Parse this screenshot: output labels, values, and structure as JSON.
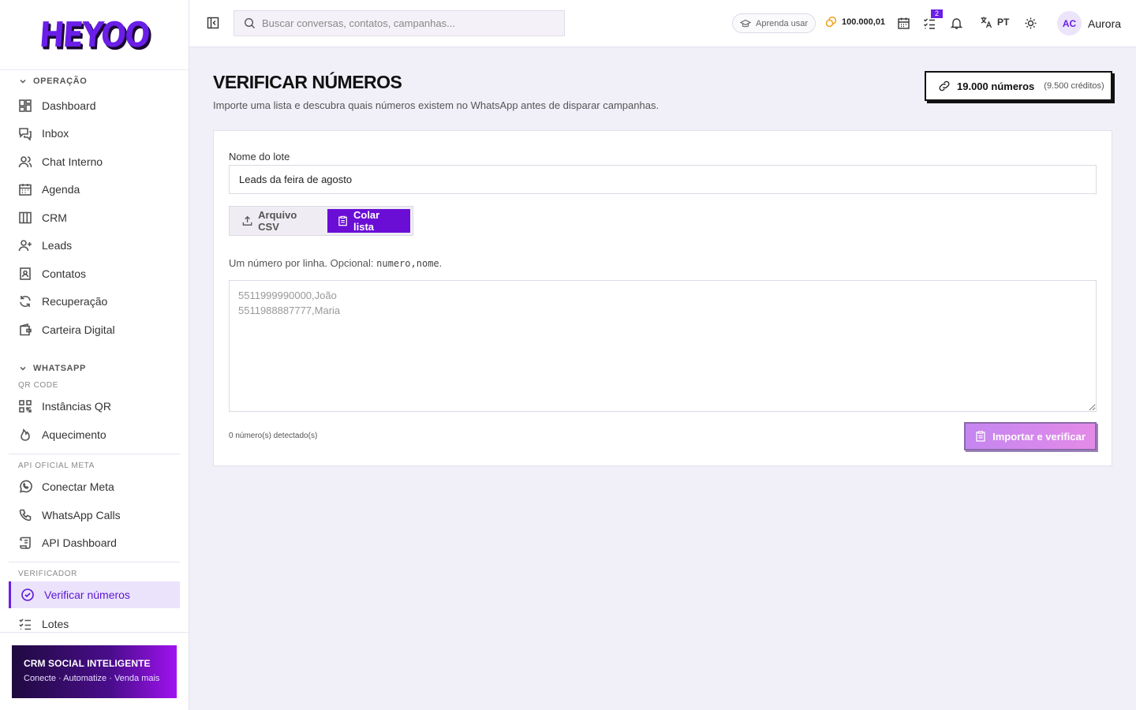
{
  "brand": {
    "logo_text": "HEYOO"
  },
  "topbar": {
    "search_placeholder": "Buscar conversas, contatos, campanhas...",
    "learn_label": "Aprenda usar",
    "credits": "100.000,01",
    "tasks_badge": "2",
    "language": "PT",
    "user": {
      "initials": "AC",
      "name": "Aurora"
    }
  },
  "sidebar": {
    "sections": {
      "operacao": "OPERAÇÃO",
      "whatsapp": "WHATSAPP",
      "qr_code": "QR CODE",
      "api_meta": "API OFICIAL META",
      "verificador": "VERIFICADOR"
    },
    "items": {
      "dashboard": "Dashboard",
      "inbox": "Inbox",
      "chat_interno": "Chat Interno",
      "agenda": "Agenda",
      "crm": "CRM",
      "leads": "Leads",
      "contatos": "Contatos",
      "recuperacao": "Recuperação",
      "carteira": "Carteira Digital",
      "instancias_qr": "Instâncias QR",
      "aquecimento": "Aquecimento",
      "conectar_meta": "Conectar Meta",
      "whatsapp_calls": "WhatsApp Calls",
      "api_dashboard": "API Dashboard",
      "verificar_numeros": "Verificar números",
      "lotes": "Lotes"
    },
    "promo": {
      "title": "CRM SOCIAL INTELIGENTE",
      "subtitle": "Conecte · Automatize · Venda mais"
    }
  },
  "page": {
    "title": "VERIFICAR NÚMEROS",
    "subtitle": "Importe uma lista e descubra quais números existem no WhatsApp antes de disparar campanhas.",
    "quota": {
      "numbers": "19.000 números",
      "credits": "(9.500 créditos)"
    }
  },
  "form": {
    "batch_label": "Nome do lote",
    "batch_value": "Leads da feira de agosto",
    "tab_csv": "Arquivo CSV",
    "tab_paste": "Colar lista",
    "hint_prefix": "Um número por linha. Opcional: ",
    "hint_code_1": "numero",
    "hint_sep": ",",
    "hint_code_2": "nome",
    "hint_suffix": ".",
    "paste_placeholder": "5511999990000,João\n5511988887777,Maria",
    "detected": "0 número(s) detectado(s)",
    "submit_label": "Importar e verificar"
  },
  "colors": {
    "accent": "#6a1ee8",
    "active_bg": "#ebe3fb",
    "page_bg": "#f1eff8"
  }
}
